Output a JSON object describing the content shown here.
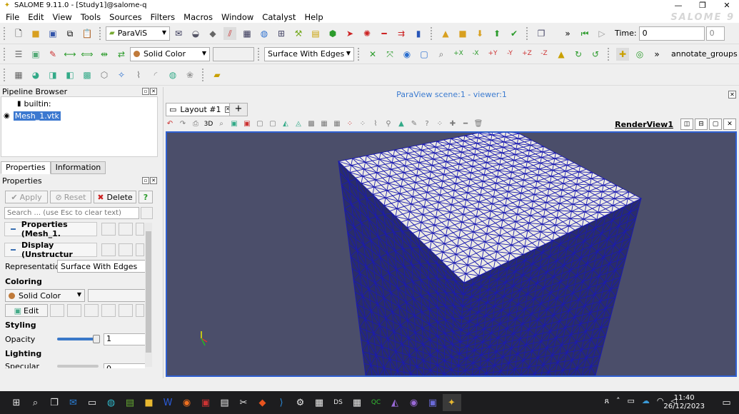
{
  "window": {
    "title": "SALOME 9.11.0 - [Study1]@salome-q",
    "logo_text": "SALOME 9"
  },
  "menu": [
    "File",
    "Edit",
    "View",
    "Tools",
    "Sources",
    "Filters",
    "Macros",
    "Window",
    "Catalyst",
    "Help"
  ],
  "toolbar1": {
    "module": "ParaViS",
    "time_label": "Time:",
    "time_value": "0",
    "time_step": "0"
  },
  "toolbar2": {
    "coloring": "Solid Color",
    "representation": "Surface With Edges",
    "annotate": "annotate_groups"
  },
  "pipeline": {
    "title": "Pipeline Browser",
    "root": "builtin:",
    "item": "Mesh_1.vtk"
  },
  "tabs": [
    "Properties",
    "Information"
  ],
  "properties": {
    "title": "Properties",
    "apply": "Apply",
    "reset": "Reset",
    "delete": "Delete",
    "help": "?",
    "search_placeholder": "Search ... (use Esc to clear text)",
    "section_properties": "Properties (Mesh_1.",
    "section_display": "Display (Unstructur",
    "representation_label": "Representation",
    "representation_value": "Surface With Edges",
    "coloring_label": "Coloring",
    "coloring_value": "Solid Color",
    "edit": "Edit",
    "styling_label": "Styling",
    "opacity_label": "Opacity",
    "opacity_value": "1",
    "opacity_level": 1,
    "lighting_label": "Lighting",
    "specular_label": "Specular",
    "specular_value": "0"
  },
  "viewer": {
    "scene_title": "ParaView scene:1 - viewer:1",
    "layout_tab": "Layout #1",
    "add_tab": "+",
    "view_3d": "3D",
    "render_view": "RenderView1",
    "background": "#4b4e6a",
    "mesh_edge_color": "#1b1bb0",
    "mesh_face_color": "#eceae4"
  },
  "taskbar": {
    "time": "11:40",
    "date": "26/12/2023"
  }
}
